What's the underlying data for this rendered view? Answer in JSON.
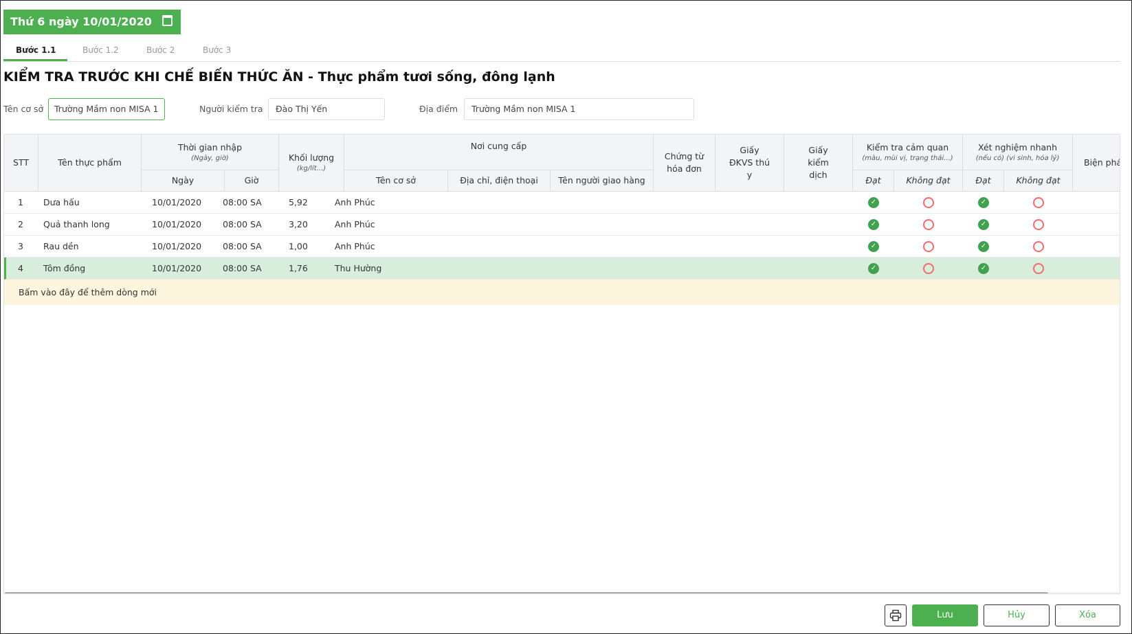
{
  "header": {
    "date": "Thứ 6 ngày 10/01/2020"
  },
  "tabs": [
    {
      "label": "Bước 1.1",
      "active": true
    },
    {
      "label": "Bước 1.2"
    },
    {
      "label": "Bước 2"
    },
    {
      "label": "Bước 3"
    }
  ],
  "title": "KIỂM TRA TRƯỚC KHI CHẾ BIẾN THỨC ĂN - Thực phẩm tươi sống, đông lạnh",
  "form": {
    "facility_label": "Tên cơ sở",
    "facility_value": "Trường Mầm non MISA 1",
    "inspector_label": "Người kiểm tra",
    "inspector_value": "Đào Thị Yến",
    "location_label": "Địa điểm",
    "location_value": "Trường Mầm non MISA 1"
  },
  "columns": {
    "stt": "STT",
    "name": "Tên thực phẩm",
    "time": "Thời gian nhập",
    "time_sub": "(Ngày, giờ)",
    "date": "Ngày",
    "hour": "Giờ",
    "weight": "Khối lượng",
    "weight_sub": "(kg/lít...)",
    "supplier": "Nơi cung cấp",
    "sup_name": "Tên cơ sở",
    "sup_addr": "Địa chỉ, điện thoại",
    "sup_deliver": "Tên người giao hàng",
    "invoice": "Chứng từ hóa đơn",
    "vet": "Giấy ĐKVS thú y",
    "quarantine": "Giấy kiểm dịch",
    "sensory": "Kiểm tra cảm quan",
    "sensory_sub": "(màu, mùi vị, trạng thái...)",
    "rapid": "Xét nghiệm nhanh",
    "rapid_sub": "(nếu có) (vi sinh, hóa lý)",
    "pass": "Đạt",
    "fail": "Không đạt",
    "measures": "Biện pháp xử lý / Ghi chú"
  },
  "rows": [
    {
      "stt": "1",
      "name": "Dưa hấu",
      "date": "10/01/2020",
      "time": "08:00 SA",
      "weight": "5,92",
      "supplier": "Anh Phúc",
      "sensory": "pass",
      "rapid": "pass"
    },
    {
      "stt": "2",
      "name": "Quả thanh long",
      "date": "10/01/2020",
      "time": "08:00 SA",
      "weight": "3,20",
      "supplier": "Anh Phúc",
      "sensory": "pass",
      "rapid": "pass"
    },
    {
      "stt": "3",
      "name": "Rau dền",
      "date": "10/01/2020",
      "time": "08:00 SA",
      "weight": "1,00",
      "supplier": "Anh Phúc",
      "sensory": "pass",
      "rapid": "pass"
    },
    {
      "stt": "4",
      "name": "Tôm đồng",
      "date": "10/01/2020",
      "time": "08:00 SA",
      "weight": "1,76",
      "supplier": "Thu Hường",
      "sensory": "pass",
      "rapid": "pass",
      "selected": true
    }
  ],
  "add_row": "Bấm vào đây để thêm dòng mới",
  "buttons": {
    "save": "Lưu",
    "cancel": "Hủy",
    "delete": "Xóa"
  },
  "colors": {
    "accent": "#4caf50",
    "selected_row": "#d8eddb",
    "add_row": "#fdf5dd",
    "fail": "#f26b6b"
  }
}
